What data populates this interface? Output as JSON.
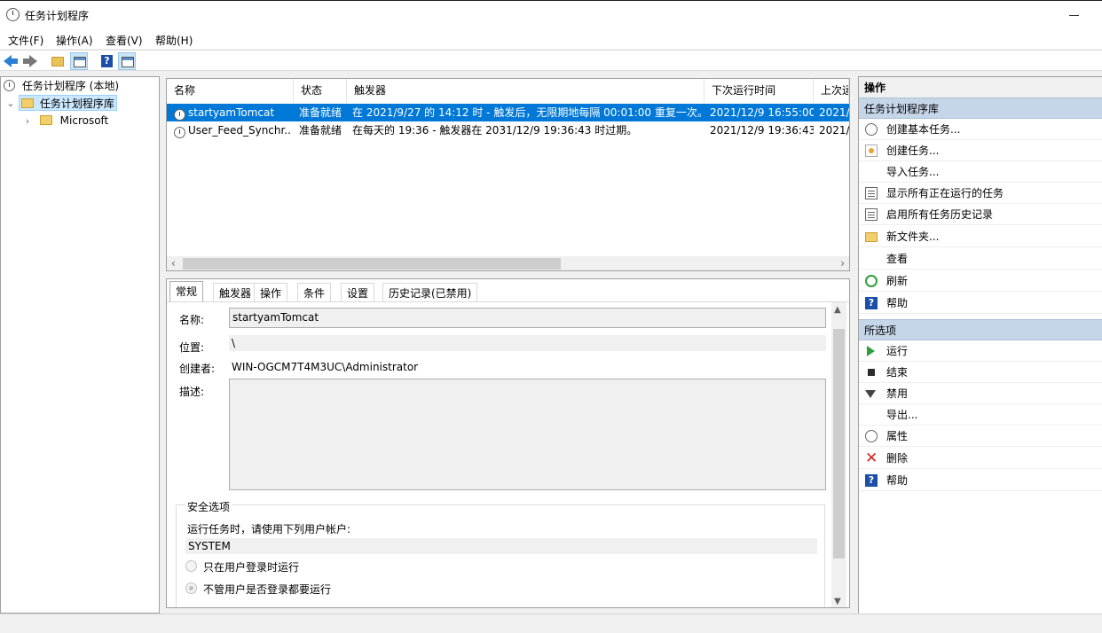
{
  "window": {
    "title": "任务计划程序"
  },
  "menu": [
    "文件(F)",
    "操作(A)",
    "查看(V)",
    "帮助(H)"
  ],
  "tree": {
    "root": "任务计划程序 (本地)",
    "library": "任务计划程序库",
    "child": "Microsoft"
  },
  "list": {
    "columns": [
      "名称",
      "状态",
      "触发器",
      "下次运行时间",
      "上次运"
    ],
    "rows": [
      {
        "name": "startyamTomcat",
        "status": "准备就绪",
        "trigger": "在 2021/9/27 的 14:12 时 - 触发后，无限期地每隔 00:01:00 重复一次。",
        "next": "2021/12/9 16:55:00",
        "last": "2021/"
      },
      {
        "name": "User_Feed_Synchr...",
        "status": "准备就绪",
        "trigger": "在每天的 19:36 - 触发器在 2031/12/9 19:36:43 时过期。",
        "next": "2021/12/9 19:36:43",
        "last": "2021/"
      }
    ]
  },
  "detail": {
    "tabs": [
      "常规",
      "触发器",
      "操作",
      "条件",
      "设置",
      "历史记录(已禁用)"
    ],
    "name_label": "名称:",
    "name_value": "startyamTomcat",
    "location_label": "位置:",
    "location_value": "\\",
    "author_label": "创建者:",
    "author_value": "WIN-OGCM7T4M3UC\\Administrator",
    "desc_label": "描述:",
    "security_title": "安全选项",
    "run_as_label": "运行任务时，请使用下列用户帐户:",
    "run_as_value": "SYSTEM",
    "radio1": "只在用户登录时运行",
    "radio2": "不管用户是否登录都要运行"
  },
  "actions": {
    "header": "操作",
    "section1": "任务计划程序库",
    "items1": [
      {
        "label": "创建基本任务...",
        "icon": "clock-icon"
      },
      {
        "label": "创建任务...",
        "icon": "task-icon"
      },
      {
        "label": "导入任务...",
        "icon": ""
      },
      {
        "label": "显示所有正在运行的任务",
        "icon": "list-icon"
      },
      {
        "label": "启用所有任务历史记录",
        "icon": "history-icon"
      },
      {
        "label": "新文件夹...",
        "icon": "folder-icon"
      },
      {
        "label": "查看",
        "icon": ""
      },
      {
        "label": "刷新",
        "icon": "refresh-icon"
      },
      {
        "label": "帮助",
        "icon": "help-icon"
      }
    ],
    "section2": "所选项",
    "items2": [
      {
        "label": "运行",
        "icon": "play-icon"
      },
      {
        "label": "结束",
        "icon": "stop-icon"
      },
      {
        "label": "禁用",
        "icon": "disable-icon"
      },
      {
        "label": "导出...",
        "icon": ""
      },
      {
        "label": "属性",
        "icon": "properties-icon"
      },
      {
        "label": "删除",
        "icon": "delete-icon"
      },
      {
        "label": "帮助",
        "icon": "help-icon"
      }
    ]
  }
}
